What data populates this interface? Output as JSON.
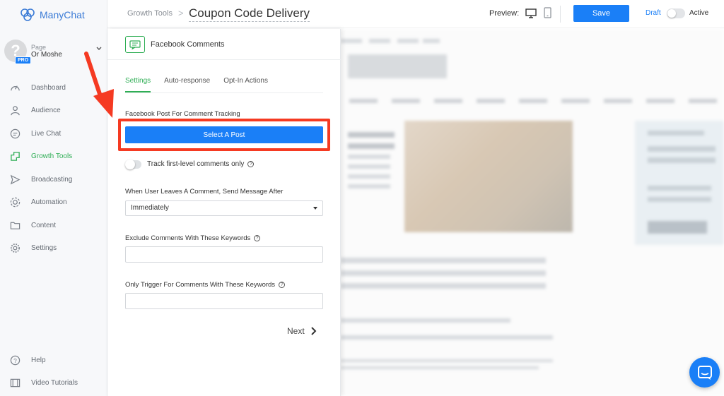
{
  "app": {
    "name": "ManyChat"
  },
  "page": {
    "label": "Page",
    "name": "Or Moshe",
    "badge": "PRO"
  },
  "sidebar": {
    "items": [
      {
        "label": "Dashboard",
        "icon": "speedometer-icon"
      },
      {
        "label": "Audience",
        "icon": "user-icon"
      },
      {
        "label": "Live Chat",
        "icon": "chat-icon"
      },
      {
        "label": "Growth Tools",
        "icon": "growth-tools-icon",
        "active": true
      },
      {
        "label": "Broadcasting",
        "icon": "send-icon"
      },
      {
        "label": "Automation",
        "icon": "automation-icon"
      },
      {
        "label": "Content",
        "icon": "folder-icon"
      },
      {
        "label": "Settings",
        "icon": "gear-icon"
      }
    ],
    "bottom_items": [
      {
        "label": "Help",
        "icon": "help-icon"
      },
      {
        "label": "Video Tutorials",
        "icon": "film-icon"
      }
    ]
  },
  "header": {
    "breadcrumb_parent": "Growth Tools",
    "breadcrumb_separator": ">",
    "title": "Coupon Code Delivery",
    "preview_label": "Preview:",
    "save_label": "Save",
    "draft_label": "Draft",
    "active_label": "Active"
  },
  "panel": {
    "title": "Facebook Comments",
    "tabs": [
      {
        "label": "Settings",
        "active": true
      },
      {
        "label": "Auto-response"
      },
      {
        "label": "Opt-In Actions"
      }
    ],
    "post_label": "Facebook Post For Comment Tracking",
    "select_post_label": "Select A Post",
    "track_first_level_label": "Track first-level comments only",
    "track_first_level_enabled": false,
    "send_after_label": "When User Leaves A Comment, Send Message After",
    "send_after_value": "Immediately",
    "exclude_label": "Exclude Comments With These Keywords",
    "exclude_value": "",
    "trigger_label": "Only Trigger For Comments With These Keywords",
    "trigger_value": "",
    "next_label": "Next"
  },
  "colors": {
    "accent": "#1a7ff7",
    "active_green": "#2fae55",
    "highlight_red": "#f53a22"
  }
}
